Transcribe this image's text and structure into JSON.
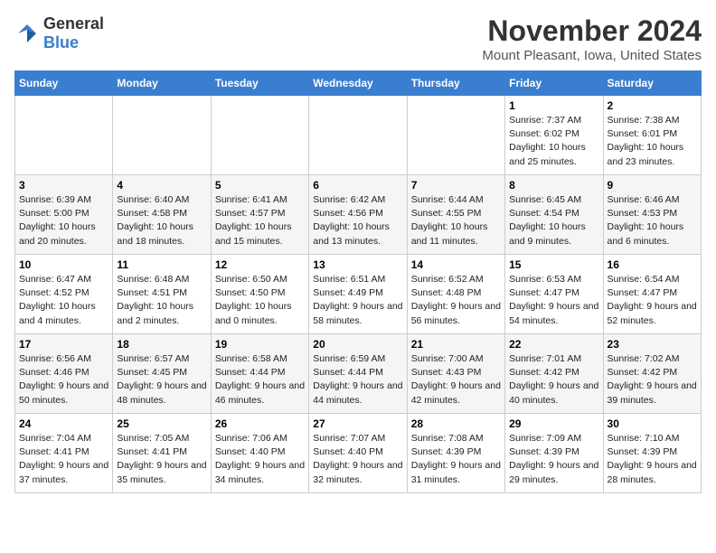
{
  "header": {
    "logo_general": "General",
    "logo_blue": "Blue",
    "month_year": "November 2024",
    "location": "Mount Pleasant, Iowa, United States"
  },
  "weekdays": [
    "Sunday",
    "Monday",
    "Tuesday",
    "Wednesday",
    "Thursday",
    "Friday",
    "Saturday"
  ],
  "weeks": [
    [
      {
        "day": "",
        "info": ""
      },
      {
        "day": "",
        "info": ""
      },
      {
        "day": "",
        "info": ""
      },
      {
        "day": "",
        "info": ""
      },
      {
        "day": "",
        "info": ""
      },
      {
        "day": "1",
        "info": "Sunrise: 7:37 AM\nSunset: 6:02 PM\nDaylight: 10 hours and 25 minutes."
      },
      {
        "day": "2",
        "info": "Sunrise: 7:38 AM\nSunset: 6:01 PM\nDaylight: 10 hours and 23 minutes."
      }
    ],
    [
      {
        "day": "3",
        "info": "Sunrise: 6:39 AM\nSunset: 5:00 PM\nDaylight: 10 hours and 20 minutes."
      },
      {
        "day": "4",
        "info": "Sunrise: 6:40 AM\nSunset: 4:58 PM\nDaylight: 10 hours and 18 minutes."
      },
      {
        "day": "5",
        "info": "Sunrise: 6:41 AM\nSunset: 4:57 PM\nDaylight: 10 hours and 15 minutes."
      },
      {
        "day": "6",
        "info": "Sunrise: 6:42 AM\nSunset: 4:56 PM\nDaylight: 10 hours and 13 minutes."
      },
      {
        "day": "7",
        "info": "Sunrise: 6:44 AM\nSunset: 4:55 PM\nDaylight: 10 hours and 11 minutes."
      },
      {
        "day": "8",
        "info": "Sunrise: 6:45 AM\nSunset: 4:54 PM\nDaylight: 10 hours and 9 minutes."
      },
      {
        "day": "9",
        "info": "Sunrise: 6:46 AM\nSunset: 4:53 PM\nDaylight: 10 hours and 6 minutes."
      }
    ],
    [
      {
        "day": "10",
        "info": "Sunrise: 6:47 AM\nSunset: 4:52 PM\nDaylight: 10 hours and 4 minutes."
      },
      {
        "day": "11",
        "info": "Sunrise: 6:48 AM\nSunset: 4:51 PM\nDaylight: 10 hours and 2 minutes."
      },
      {
        "day": "12",
        "info": "Sunrise: 6:50 AM\nSunset: 4:50 PM\nDaylight: 10 hours and 0 minutes."
      },
      {
        "day": "13",
        "info": "Sunrise: 6:51 AM\nSunset: 4:49 PM\nDaylight: 9 hours and 58 minutes."
      },
      {
        "day": "14",
        "info": "Sunrise: 6:52 AM\nSunset: 4:48 PM\nDaylight: 9 hours and 56 minutes."
      },
      {
        "day": "15",
        "info": "Sunrise: 6:53 AM\nSunset: 4:47 PM\nDaylight: 9 hours and 54 minutes."
      },
      {
        "day": "16",
        "info": "Sunrise: 6:54 AM\nSunset: 4:47 PM\nDaylight: 9 hours and 52 minutes."
      }
    ],
    [
      {
        "day": "17",
        "info": "Sunrise: 6:56 AM\nSunset: 4:46 PM\nDaylight: 9 hours and 50 minutes."
      },
      {
        "day": "18",
        "info": "Sunrise: 6:57 AM\nSunset: 4:45 PM\nDaylight: 9 hours and 48 minutes."
      },
      {
        "day": "19",
        "info": "Sunrise: 6:58 AM\nSunset: 4:44 PM\nDaylight: 9 hours and 46 minutes."
      },
      {
        "day": "20",
        "info": "Sunrise: 6:59 AM\nSunset: 4:44 PM\nDaylight: 9 hours and 44 minutes."
      },
      {
        "day": "21",
        "info": "Sunrise: 7:00 AM\nSunset: 4:43 PM\nDaylight: 9 hours and 42 minutes."
      },
      {
        "day": "22",
        "info": "Sunrise: 7:01 AM\nSunset: 4:42 PM\nDaylight: 9 hours and 40 minutes."
      },
      {
        "day": "23",
        "info": "Sunrise: 7:02 AM\nSunset: 4:42 PM\nDaylight: 9 hours and 39 minutes."
      }
    ],
    [
      {
        "day": "24",
        "info": "Sunrise: 7:04 AM\nSunset: 4:41 PM\nDaylight: 9 hours and 37 minutes."
      },
      {
        "day": "25",
        "info": "Sunrise: 7:05 AM\nSunset: 4:41 PM\nDaylight: 9 hours and 35 minutes."
      },
      {
        "day": "26",
        "info": "Sunrise: 7:06 AM\nSunset: 4:40 PM\nDaylight: 9 hours and 34 minutes."
      },
      {
        "day": "27",
        "info": "Sunrise: 7:07 AM\nSunset: 4:40 PM\nDaylight: 9 hours and 32 minutes."
      },
      {
        "day": "28",
        "info": "Sunrise: 7:08 AM\nSunset: 4:39 PM\nDaylight: 9 hours and 31 minutes."
      },
      {
        "day": "29",
        "info": "Sunrise: 7:09 AM\nSunset: 4:39 PM\nDaylight: 9 hours and 29 minutes."
      },
      {
        "day": "30",
        "info": "Sunrise: 7:10 AM\nSunset: 4:39 PM\nDaylight: 9 hours and 28 minutes."
      }
    ]
  ]
}
